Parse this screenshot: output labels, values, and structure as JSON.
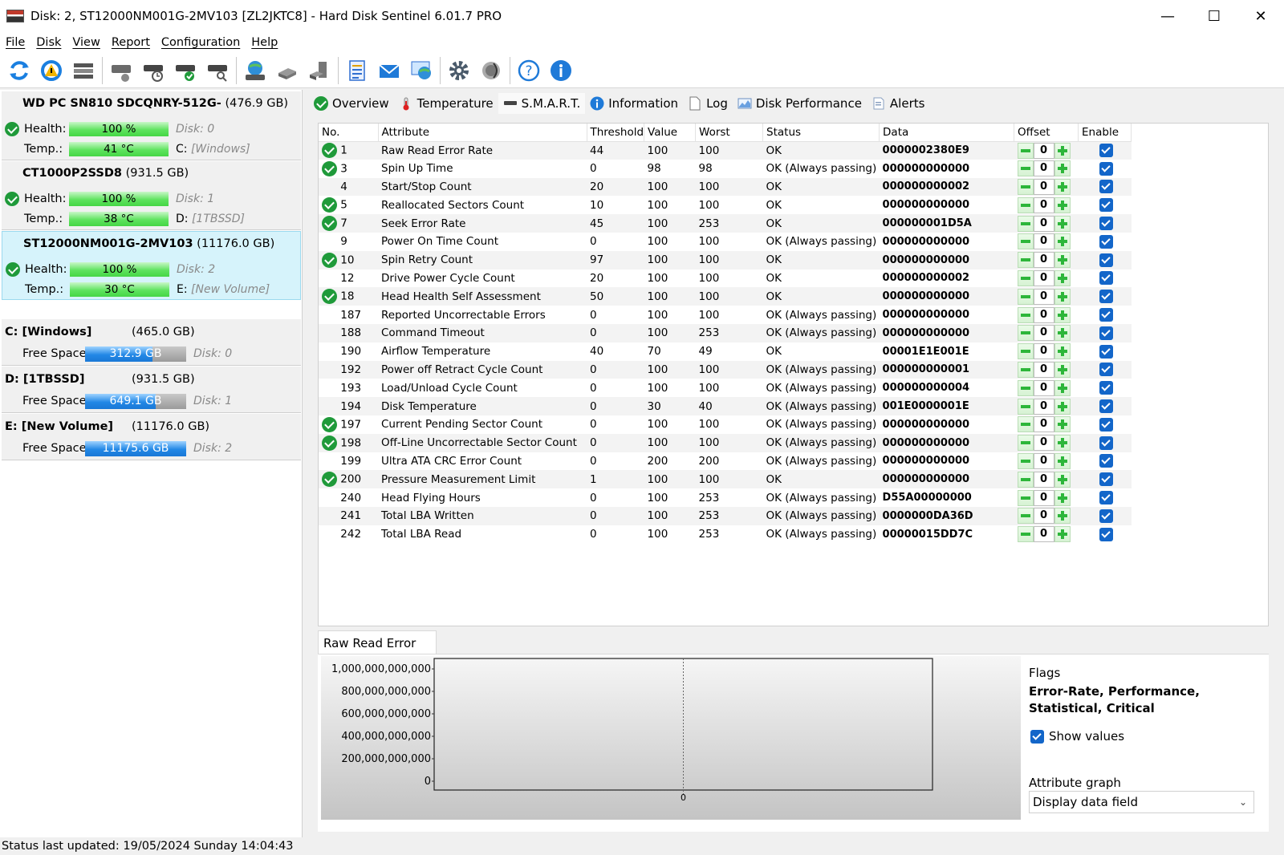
{
  "window": {
    "title": "Disk: 2, ST12000NM001G-2MV103 [ZL2JKTC8]  -  Hard Disk Sentinel 6.01.7 PRO"
  },
  "menu": [
    "File",
    "Disk",
    "View",
    "Report",
    "Configuration",
    "Help"
  ],
  "disks": [
    {
      "name": "WD PC SN810 SDCQNRY-512G-",
      "size": "(476.9 GB)",
      "health_label": "Health:",
      "health": "100 %",
      "disk_label": "Disk: 0",
      "temp_label": "Temp.:",
      "temp": "41 °C",
      "drive": "C:",
      "volume": "[Windows]",
      "selected": false
    },
    {
      "name": "CT1000P2SSD8",
      "size": "(931.5 GB)",
      "health_label": "Health:",
      "health": "100 %",
      "disk_label": "Disk: 1",
      "temp_label": "Temp.:",
      "temp": "38 °C",
      "drive": "D:",
      "volume": "[1TBSSD]",
      "selected": false
    },
    {
      "name": "ST12000NM001G-2MV103",
      "size": "(11176.0 GB)",
      "health_label": "Health:",
      "health": "100 %",
      "disk_label": "Disk: 2",
      "temp_label": "Temp.:",
      "temp": "30 °C",
      "drive": "E:",
      "volume": "[New Volume]",
      "selected": true
    }
  ],
  "volumes": [
    {
      "name": "C: [Windows]",
      "size": "(465.0 GB)",
      "free_label": "Free Space",
      "free": "312.9 GB",
      "free_fraction": 0.67,
      "disk": "Disk: 0"
    },
    {
      "name": "D: [1TBSSD]",
      "size": "(931.5 GB)",
      "free_label": "Free Space",
      "free": "649.1 GB",
      "free_fraction": 0.7,
      "disk": "Disk: 1"
    },
    {
      "name": "E: [New Volume]",
      "size": "(11176.0 GB)",
      "free_label": "Free Space",
      "free": "11175.6 GB",
      "free_fraction": 1.0,
      "disk": "Disk: 2"
    }
  ],
  "tabs": [
    "Overview",
    "Temperature",
    "S.M.A.R.T.",
    "Information",
    "Log",
    "Disk Performance",
    "Alerts"
  ],
  "smart": {
    "columns": [
      "No.",
      "Attribute",
      "Threshold",
      "Value",
      "Worst",
      "Status",
      "Data",
      "Offset",
      "Enable"
    ],
    "rows": [
      {
        "icon": true,
        "no": "1",
        "attr": "Raw Read Error Rate",
        "thr": "44",
        "val": "100",
        "worst": "100",
        "status": "OK",
        "data": "0000002380E9",
        "offset": "0"
      },
      {
        "icon": true,
        "no": "3",
        "attr": "Spin Up Time",
        "thr": "0",
        "val": "98",
        "worst": "98",
        "status": "OK (Always passing)",
        "data": "000000000000",
        "offset": "0"
      },
      {
        "icon": false,
        "no": "4",
        "attr": "Start/Stop Count",
        "thr": "20",
        "val": "100",
        "worst": "100",
        "status": "OK",
        "data": "000000000002",
        "offset": "0"
      },
      {
        "icon": true,
        "no": "5",
        "attr": "Reallocated Sectors Count",
        "thr": "10",
        "val": "100",
        "worst": "100",
        "status": "OK",
        "data": "000000000000",
        "offset": "0"
      },
      {
        "icon": true,
        "no": "7",
        "attr": "Seek Error Rate",
        "thr": "45",
        "val": "100",
        "worst": "253",
        "status": "OK",
        "data": "000000001D5A",
        "offset": "0"
      },
      {
        "icon": false,
        "no": "9",
        "attr": "Power On Time Count",
        "thr": "0",
        "val": "100",
        "worst": "100",
        "status": "OK (Always passing)",
        "data": "000000000000",
        "offset": "0"
      },
      {
        "icon": true,
        "no": "10",
        "attr": "Spin Retry Count",
        "thr": "97",
        "val": "100",
        "worst": "100",
        "status": "OK",
        "data": "000000000000",
        "offset": "0"
      },
      {
        "icon": false,
        "no": "12",
        "attr": "Drive Power Cycle Count",
        "thr": "20",
        "val": "100",
        "worst": "100",
        "status": "OK",
        "data": "000000000002",
        "offset": "0"
      },
      {
        "icon": true,
        "no": "18",
        "attr": "Head Health Self Assessment",
        "thr": "50",
        "val": "100",
        "worst": "100",
        "status": "OK",
        "data": "000000000000",
        "offset": "0"
      },
      {
        "icon": false,
        "no": "187",
        "attr": "Reported Uncorrectable Errors",
        "thr": "0",
        "val": "100",
        "worst": "100",
        "status": "OK (Always passing)",
        "data": "000000000000",
        "offset": "0"
      },
      {
        "icon": false,
        "no": "188",
        "attr": "Command Timeout",
        "thr": "0",
        "val": "100",
        "worst": "253",
        "status": "OK (Always passing)",
        "data": "000000000000",
        "offset": "0"
      },
      {
        "icon": false,
        "no": "190",
        "attr": "Airflow Temperature",
        "thr": "40",
        "val": "70",
        "worst": "49",
        "status": "OK",
        "data": "00001E1E001E",
        "offset": "0"
      },
      {
        "icon": false,
        "no": "192",
        "attr": "Power off Retract Cycle Count",
        "thr": "0",
        "val": "100",
        "worst": "100",
        "status": "OK (Always passing)",
        "data": "000000000001",
        "offset": "0"
      },
      {
        "icon": false,
        "no": "193",
        "attr": "Load/Unload Cycle Count",
        "thr": "0",
        "val": "100",
        "worst": "100",
        "status": "OK (Always passing)",
        "data": "000000000004",
        "offset": "0"
      },
      {
        "icon": false,
        "no": "194",
        "attr": "Disk Temperature",
        "thr": "0",
        "val": "30",
        "worst": "40",
        "status": "OK (Always passing)",
        "data": "001E0000001E",
        "offset": "0"
      },
      {
        "icon": true,
        "no": "197",
        "attr": "Current Pending Sector Count",
        "thr": "0",
        "val": "100",
        "worst": "100",
        "status": "OK (Always passing)",
        "data": "000000000000",
        "offset": "0"
      },
      {
        "icon": true,
        "no": "198",
        "attr": "Off-Line Uncorrectable Sector Count",
        "thr": "0",
        "val": "100",
        "worst": "100",
        "status": "OK (Always passing)",
        "data": "000000000000",
        "offset": "0"
      },
      {
        "icon": false,
        "no": "199",
        "attr": "Ultra ATA CRC Error Count",
        "thr": "0",
        "val": "200",
        "worst": "200",
        "status": "OK (Always passing)",
        "data": "000000000000",
        "offset": "0"
      },
      {
        "icon": true,
        "no": "200",
        "attr": "Pressure Measurement Limit",
        "thr": "1",
        "val": "100",
        "worst": "100",
        "status": "OK",
        "data": "000000000000",
        "offset": "0"
      },
      {
        "icon": false,
        "no": "240",
        "attr": "Head Flying Hours",
        "thr": "0",
        "val": "100",
        "worst": "253",
        "status": "OK (Always passing)",
        "data": "D55A00000000",
        "offset": "0"
      },
      {
        "icon": false,
        "no": "241",
        "attr": "Total LBA Written",
        "thr": "0",
        "val": "100",
        "worst": "253",
        "status": "OK (Always passing)",
        "data": "0000000DA36D",
        "offset": "0"
      },
      {
        "icon": false,
        "no": "242",
        "attr": "Total LBA Read",
        "thr": "0",
        "val": "100",
        "worst": "253",
        "status": "OK (Always passing)",
        "data": "00000015DD7C",
        "offset": "0"
      }
    ]
  },
  "graph": {
    "tab_label": "Raw Read Error Rate",
    "yticks": [
      "1,000,000,000,000",
      "800,000,000,000",
      "600,000,000,000",
      "400,000,000,000",
      "200,000,000,000",
      "0"
    ],
    "xtick": "0"
  },
  "flags": {
    "label": "Flags",
    "value": "Error-Rate, Performance, Statistical, Critical"
  },
  "show_values": "Show values",
  "attribute_graph": {
    "label": "Attribute graph",
    "value": "Display data field"
  },
  "status_bar": "Status last updated: 19/05/2024 Sunday 14:04:43",
  "colors": {
    "health_bar": "#45d645",
    "free_bar": "#1a78d6",
    "selected_disk": "#d6f3fb",
    "ok_icon": "#1f9a3a"
  }
}
